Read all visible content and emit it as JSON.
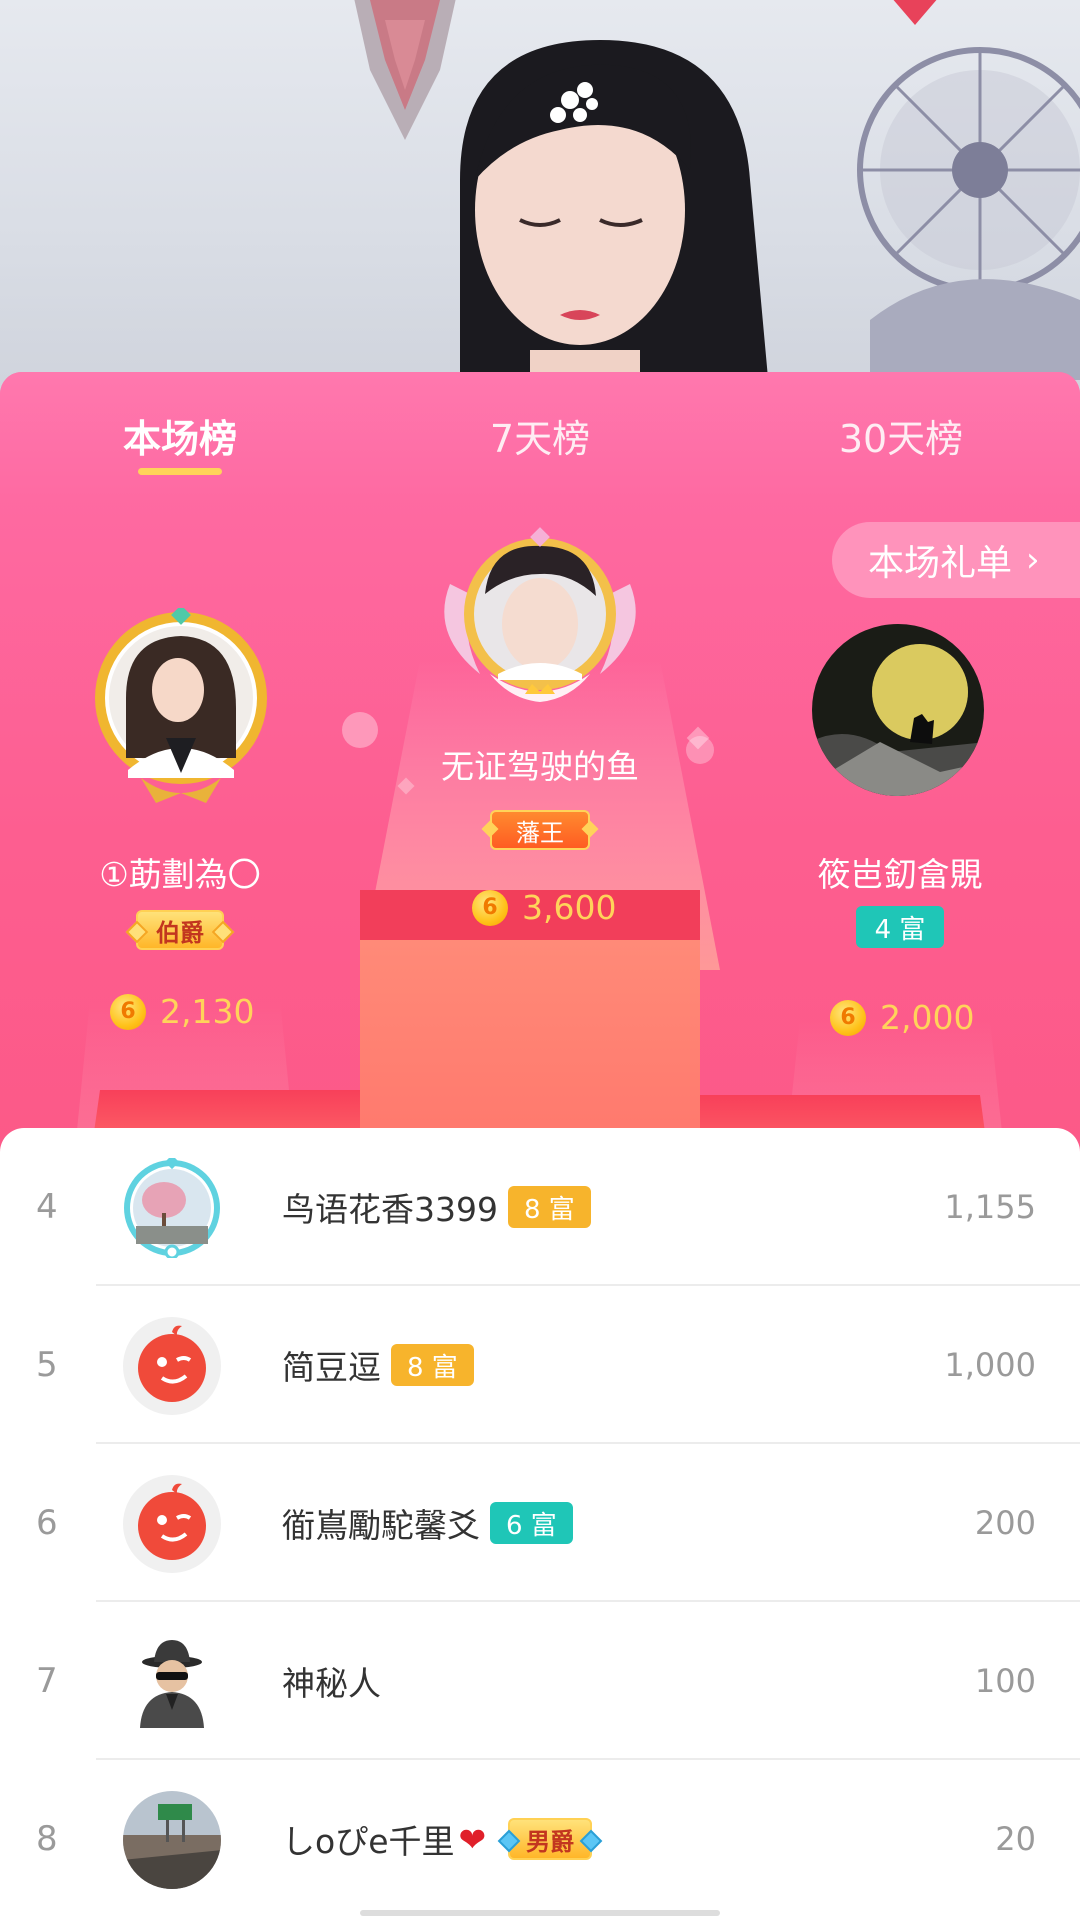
{
  "tabs": [
    {
      "label": "本场榜",
      "active": true
    },
    {
      "label": "7天榜",
      "active": false
    },
    {
      "label": "30天榜",
      "active": false
    }
  ],
  "gift_list_button": {
    "label": "本场礼单",
    "icon": "chevron-right-icon"
  },
  "podium": {
    "first": {
      "rank": 1,
      "name": "无证驾驶的鱼",
      "badge": "藩王",
      "score": "3,600"
    },
    "second": {
      "rank": 2,
      "name": "①莇劃為〇",
      "badge": "伯爵",
      "score": "2,130"
    },
    "third": {
      "rank": 3,
      "name": "筱岜釖畣覞",
      "badge": "4 富",
      "score": "2,000"
    }
  },
  "coin_symbol": "6",
  "ranking_list": [
    {
      "rank": "4",
      "name": "鸟语花香3399",
      "badge": "8 富",
      "badge_type": "gold",
      "score": "1,155"
    },
    {
      "rank": "5",
      "name": "简豆逗",
      "badge": "8 富",
      "badge_type": "gold",
      "score": "1,000"
    },
    {
      "rank": "6",
      "name": "衜嶌勵駝馨爻",
      "badge": "6 富",
      "badge_type": "teal",
      "score": "200"
    },
    {
      "rank": "7",
      "name": "神秘人",
      "badge": "",
      "badge_type": "",
      "score": "100"
    },
    {
      "rank": "8",
      "name": "しoぴe千里",
      "name_suffix": "❤",
      "badge": "男爵",
      "badge_type": "noble",
      "score": "20"
    }
  ],
  "colors": {
    "panel_top": "#fe6ea8",
    "panel_bottom": "#fb4d73",
    "accent_yellow": "#ffd35a",
    "rich_gold": "#f7b42c",
    "rich_teal": "#1fc6b7"
  }
}
